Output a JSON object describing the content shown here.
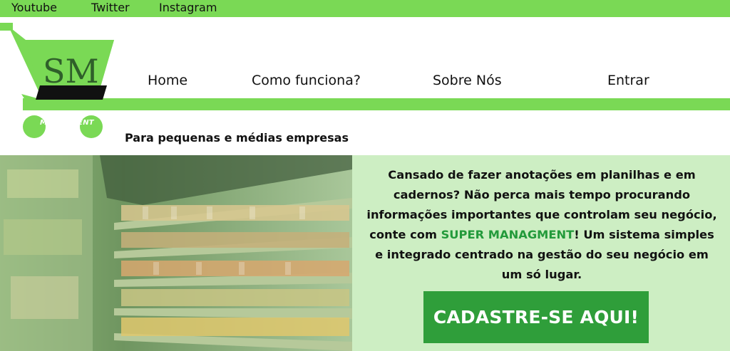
{
  "topbar": {
    "links": [
      "Youtube",
      "Twitter",
      "Instagram"
    ]
  },
  "logo": {
    "monogram": "SM",
    "name": "SUPER MANAGMENT",
    "icon": "shopping-cart-icon"
  },
  "nav": {
    "items": [
      "Home",
      "Como funciona?",
      "Sobre Nós",
      "Entrar"
    ]
  },
  "tagline": "Para pequenas e médias empresas",
  "hero": {
    "image": "supermarket-shelves-photo",
    "text_before": "Cansado de fazer anotações em planilhas e em cadernos? Não perca mais tempo procurando informações importantes que controlam seu negócio, conte com ",
    "brand": "SUPER MANAGMENT",
    "text_after": "! Um sistema simples e integrado centrado na gestão do seu negócio em um só lugar.",
    "cta_label": "CADASTRE-SE AQUI!"
  },
  "colors": {
    "accent_green": "#7ad955",
    "panel_green": "#cdeec3",
    "cta_green": "#2f9e3a",
    "brand_highlight": "#239a3b"
  }
}
